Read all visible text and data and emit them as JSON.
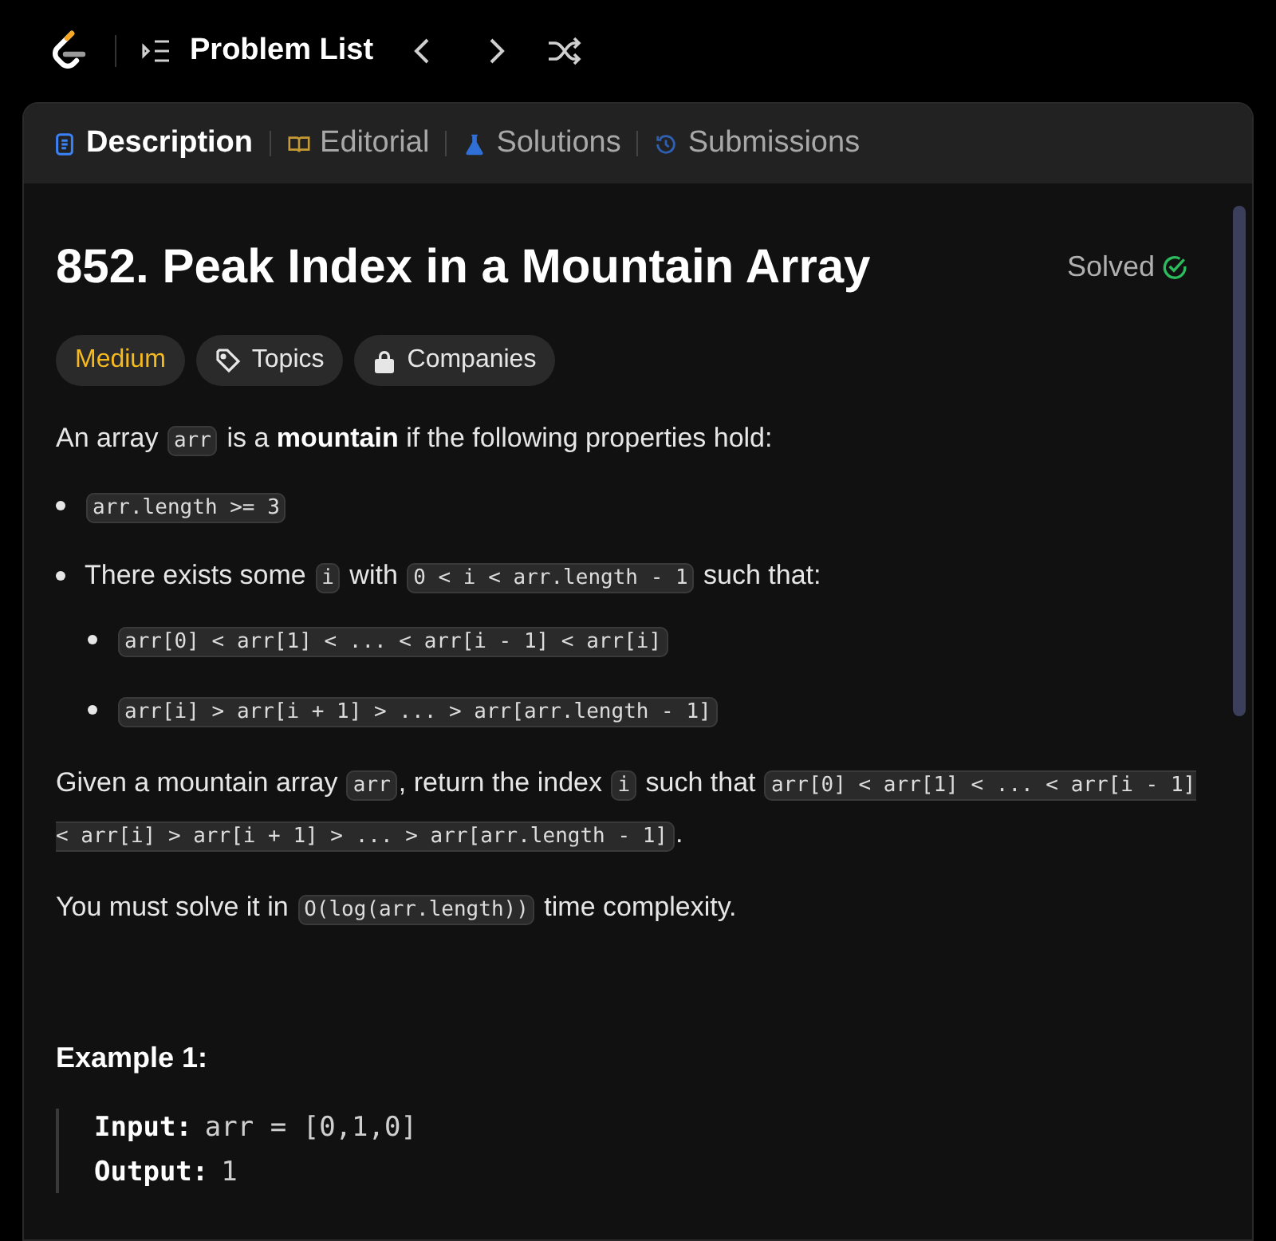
{
  "nav": {
    "title": "Problem List"
  },
  "tabs": [
    {
      "label": "Description",
      "selected": true,
      "kind": "doc"
    },
    {
      "label": "Editorial",
      "selected": false,
      "kind": "book"
    },
    {
      "label": "Solutions",
      "selected": false,
      "kind": "flask"
    },
    {
      "label": "Submissions",
      "selected": false,
      "kind": "history"
    }
  ],
  "problem": {
    "title": "852. Peak Index in a Mountain Array",
    "status": "Solved",
    "solved": true,
    "tags": [
      {
        "label": "Medium",
        "kind": "difficulty"
      },
      {
        "label": "Topics",
        "kind": "topics"
      },
      {
        "label": "Companies",
        "kind": "companies"
      }
    ],
    "intro": [
      {
        "kind": "text",
        "text": "An array "
      },
      {
        "kind": "code",
        "text": "arr"
      },
      {
        "kind": "text",
        "text": " is a "
      },
      {
        "kind": "bold",
        "text": "mountain"
      },
      {
        "kind": "text",
        "text": " if the following properties hold:"
      }
    ],
    "bullets": [
      {
        "segments": [
          {
            "kind": "code",
            "text": "arr.length >= 3"
          }
        ]
      },
      {
        "segments": [
          {
            "kind": "text",
            "text": "There exists some "
          },
          {
            "kind": "code",
            "text": "i"
          },
          {
            "kind": "text",
            "text": " with "
          },
          {
            "kind": "code",
            "text": "0 < i < arr.length - 1"
          },
          {
            "kind": "text",
            "text": " such that:"
          }
        ],
        "children": [
          {
            "segments": [
              {
                "kind": "code",
                "text": "arr[0] < arr[1] < ... < arr[i - 1] < arr[i]"
              }
            ]
          },
          {
            "segments": [
              {
                "kind": "code",
                "text": "arr[i] > arr[i + 1] > ... > arr[arr.length - 1]"
              }
            ]
          }
        ]
      }
    ],
    "paragraphs": [
      [
        {
          "kind": "text",
          "text": "Given a mountain array "
        },
        {
          "kind": "code",
          "text": "arr"
        },
        {
          "kind": "text",
          "text": ", return the index "
        },
        {
          "kind": "code",
          "text": "i"
        },
        {
          "kind": "text",
          "text": " such that "
        },
        {
          "kind": "code",
          "text": "arr[0] < arr[1] < ... < arr[i - 1] < arr[i] > arr[i + 1] > ... > arr[arr.length - 1]"
        },
        {
          "kind": "text",
          "text": "."
        }
      ],
      [
        {
          "kind": "text",
          "text": "You must solve it in "
        },
        {
          "kind": "code",
          "text": "O(log(arr.length))"
        },
        {
          "kind": "text",
          "text": " time complexity."
        }
      ]
    ],
    "example": {
      "title": "Example 1:",
      "lines": [
        {
          "label": "Input:",
          "value": "arr = [0,1,0]"
        },
        {
          "label": "Output:",
          "value": "1"
        }
      ]
    }
  }
}
